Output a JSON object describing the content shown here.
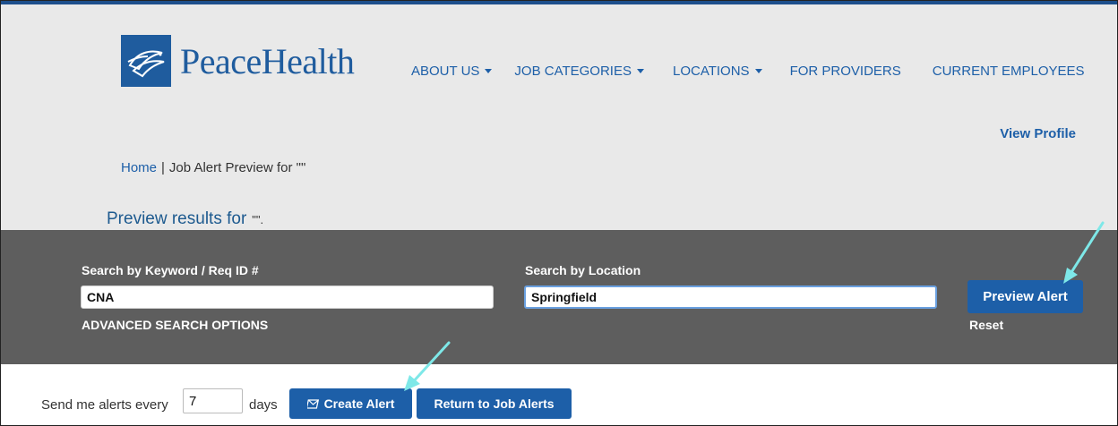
{
  "header": {
    "logo_text": "PeaceHealth",
    "nav": [
      {
        "label": "ABOUT US"
      },
      {
        "label": "JOB CATEGORIES"
      },
      {
        "label": "LOCATIONS"
      },
      {
        "label": "FOR PROVIDERS"
      },
      {
        "label": "CURRENT EMPLOYEES"
      }
    ],
    "view_profile": "View Profile"
  },
  "breadcrumb": {
    "home": "Home",
    "separator": "|",
    "current": "Job Alert Preview for \"\""
  },
  "preview": {
    "title": "Preview results for",
    "query": "\"\"."
  },
  "search": {
    "keyword_label": "Search by Keyword / Req ID #",
    "keyword_value": "CNA",
    "location_label": "Search by Location",
    "location_value": "Springfield",
    "advanced": "ADVANCED SEARCH OPTIONS",
    "preview_button": "Preview Alert",
    "reset": "Reset"
  },
  "alerts": {
    "label": "Send me alerts every",
    "days_value": "7",
    "days_label": "days",
    "create_button": "Create Alert",
    "return_button": "Return to Job Alerts"
  },
  "colors": {
    "brand": "#1d5fa8",
    "panel": "#5e5e5e",
    "header_bg": "#e9e9e9",
    "arrow": "#7ee8e8"
  },
  "icons": [
    "logo-dove-icon",
    "caret-down-icon",
    "envelope-icon",
    "annotation-arrow-icon"
  ]
}
